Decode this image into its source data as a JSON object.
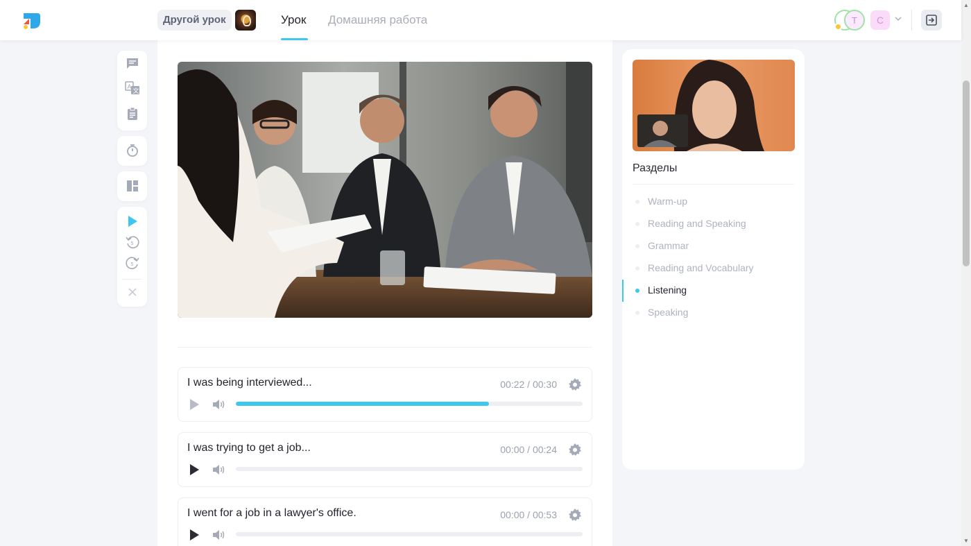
{
  "header": {
    "other_lesson_label": "Другой урок",
    "tabs": [
      {
        "label": "Урок",
        "active": true
      },
      {
        "label": "Домашняя работа",
        "active": false
      }
    ],
    "participants": [
      {
        "initial": "Т"
      },
      {
        "initial": "С"
      }
    ],
    "accent_color": "#3ec7ee"
  },
  "toolbar": {
    "icons": [
      "chat-icon",
      "translate-icon",
      "clipboard-icon",
      "timer-icon",
      "layout-icon",
      "play-icon",
      "rewind-5-icon",
      "forward-5-icon",
      "close-icon"
    ]
  },
  "audio_tracks": [
    {
      "title": "I was being interviewed...",
      "time": "00:22 / 00:30",
      "progress": 0.73,
      "playing": true
    },
    {
      "title": "I was trying to get a job...",
      "time": "00:00 / 00:24",
      "progress": 0,
      "playing": false
    },
    {
      "title": "I went for a job in a lawyer's office.",
      "time": "00:00 / 00:53",
      "progress": 0,
      "playing": false
    }
  ],
  "sidebar": {
    "title": "Разделы",
    "sections": [
      {
        "label": "Warm-up",
        "active": false
      },
      {
        "label": "Reading and Speaking",
        "active": false
      },
      {
        "label": "Grammar",
        "active": false
      },
      {
        "label": "Reading and Vocabulary",
        "active": false
      },
      {
        "label": "Listening",
        "active": true
      },
      {
        "label": "Speaking",
        "active": false
      }
    ]
  }
}
